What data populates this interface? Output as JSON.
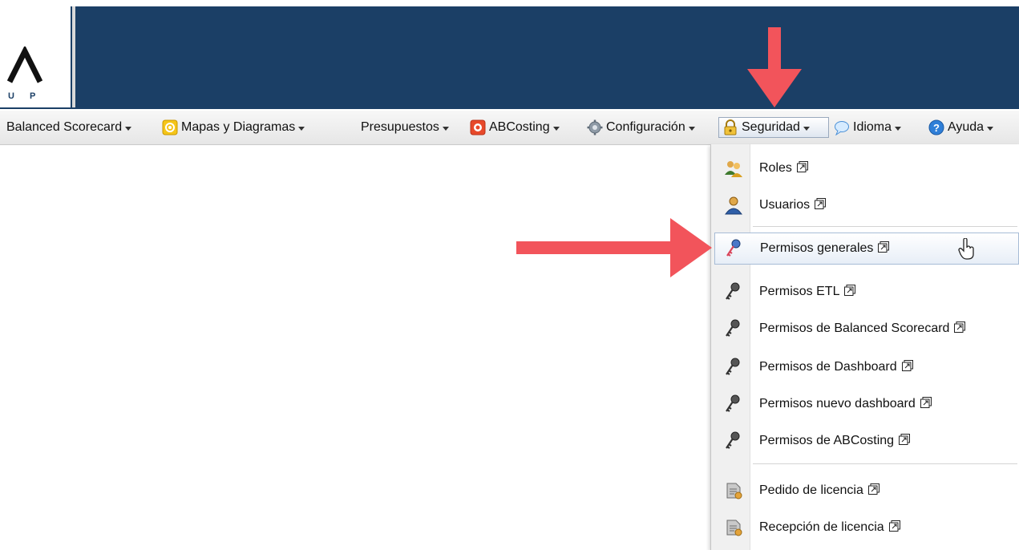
{
  "logo": {
    "text": "U P"
  },
  "menu": {
    "items": [
      {
        "label": "Balanced Scorecard"
      },
      {
        "label": "Mapas y Diagramas"
      },
      {
        "label": "Presupuestos"
      },
      {
        "label": "ABCosting"
      },
      {
        "label": "Configuración"
      },
      {
        "label": "Seguridad"
      },
      {
        "label": "Idioma"
      },
      {
        "label": "Ayuda"
      }
    ]
  },
  "dropdown": {
    "items": [
      {
        "label": "Roles",
        "icon": "roles-icon"
      },
      {
        "label": "Usuarios",
        "icon": "user-icon"
      },
      {
        "label": "Permisos generales",
        "icon": "key-icon"
      },
      {
        "label": "Permisos ETL",
        "icon": "key-icon"
      },
      {
        "label": "Permisos de Balanced Scorecard",
        "icon": "key-icon"
      },
      {
        "label": "Permisos de Dashboard",
        "icon": "key-icon"
      },
      {
        "label": "Permisos nuevo dashboard",
        "icon": "key-icon"
      },
      {
        "label": "Permisos de ABCosting",
        "icon": "key-icon"
      },
      {
        "label": "Pedido de licencia",
        "icon": "license-icon"
      },
      {
        "label": "Recepción de licencia",
        "icon": "license-icon"
      }
    ]
  },
  "colors": {
    "header": "#1b3f66",
    "arrow": "#f2545b",
    "menubar": "#ececec"
  }
}
